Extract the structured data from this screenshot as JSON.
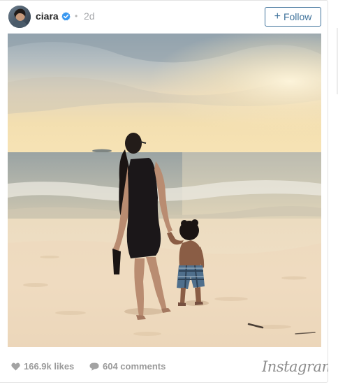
{
  "post": {
    "username": "ciara",
    "separator": "•",
    "time": "2d",
    "follow_label": "Follow",
    "follow_plus": "+"
  },
  "stats": {
    "likes": "166.9k likes",
    "comments": "604 comments"
  },
  "brand": {
    "logo_text": "Instagram"
  },
  "colors": {
    "accent": "#3f729b",
    "verified": "#3897f0",
    "muted": "#9a9a9a"
  },
  "icons": [
    "verified-badge-icon",
    "heart-icon",
    "comment-bubble-icon",
    "instagram-logo"
  ]
}
